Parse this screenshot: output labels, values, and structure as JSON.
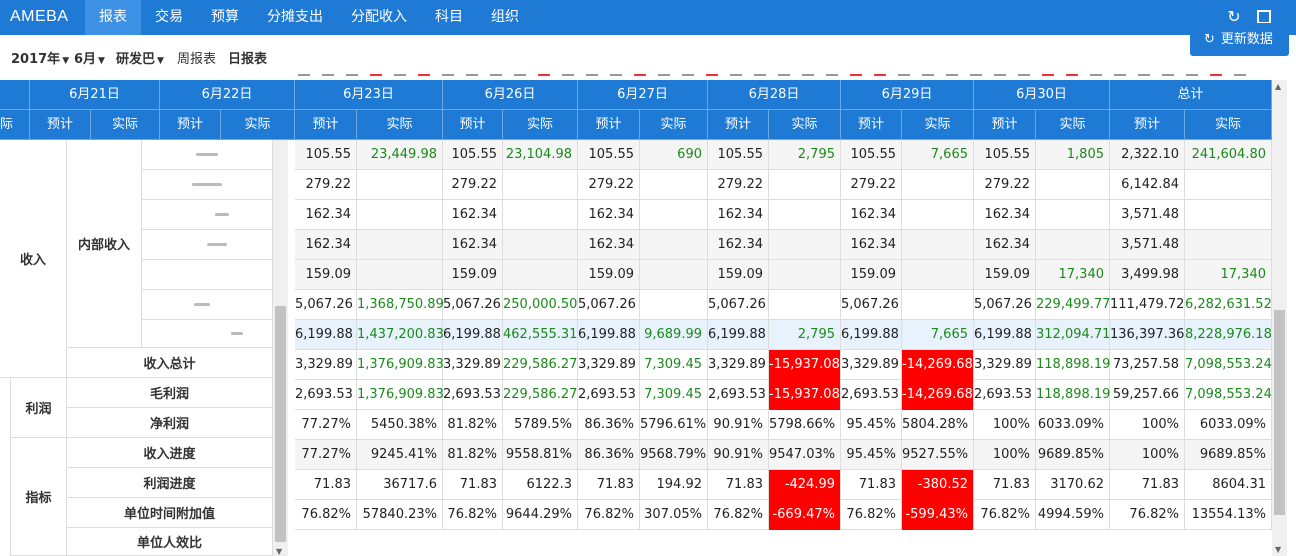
{
  "nav": {
    "brand": "AMEBA",
    "items": [
      {
        "label": "报表",
        "active": true
      },
      {
        "label": "交易"
      },
      {
        "label": "预算"
      },
      {
        "label": "分摊支出"
      },
      {
        "label": "分配收入"
      },
      {
        "label": "科目"
      },
      {
        "label": "组织"
      }
    ],
    "icons": [
      "refresh-icon",
      "expand-icon"
    ]
  },
  "toolbar": {
    "year": "2017年",
    "month": "6月",
    "dept": "研发巴",
    "weekly": "周报表",
    "daily": "日报表",
    "update_label": "更新数据"
  },
  "header": {
    "dates": [
      "6月21日",
      "6月22日",
      "6月23日",
      "6月26日",
      "6月27日",
      "6月28日",
      "6月29日",
      "6月30日",
      "总计"
    ],
    "partial_actual": "际",
    "forecast": "预计",
    "actual": "实际"
  },
  "left": {
    "income": "收入",
    "internal_income": "内部收入",
    "income_total": "收入总计",
    "profit": "利润",
    "gross_profit": "毛利润",
    "net_profit": "净利润",
    "indicators": "指标",
    "income_progress": "收入进度",
    "profit_progress": "利润进度",
    "unit_time_value": "单位时间附加值",
    "per_capita_ratio": "单位人效比"
  },
  "rows": [
    {
      "cells": [
        "105.55",
        "23,449.98",
        "105.55",
        "23,104.98",
        "105.55",
        "690",
        "105.55",
        "2,795",
        "105.55",
        "7,665",
        "105.55",
        "1,805",
        "2,322.10",
        "241,604.80"
      ],
      "green": [
        1,
        3,
        5,
        7,
        9,
        11,
        13
      ],
      "red": []
    },
    {
      "cells": [
        "279.22",
        "",
        "279.22",
        "",
        "279.22",
        "",
        "279.22",
        "",
        "279.22",
        "",
        "279.22",
        "",
        "6,142.84",
        ""
      ],
      "green": [],
      "red": []
    },
    {
      "cells": [
        "162.34",
        "",
        "162.34",
        "",
        "162.34",
        "",
        "162.34",
        "",
        "162.34",
        "",
        "162.34",
        "",
        "3,571.48",
        ""
      ],
      "green": [],
      "red": []
    },
    {
      "cells": [
        "162.34",
        "",
        "162.34",
        "",
        "162.34",
        "",
        "162.34",
        "",
        "162.34",
        "",
        "162.34",
        "",
        "3,571.48",
        ""
      ],
      "green": [],
      "red": []
    },
    {
      "cells": [
        "159.09",
        "",
        "159.09",
        "",
        "159.09",
        "",
        "159.09",
        "",
        "159.09",
        "",
        "159.09",
        "17,340",
        "3,499.98",
        "17,340"
      ],
      "green": [
        11,
        13
      ],
      "red": []
    },
    {
      "cells": [
        "5,067.26",
        "1,368,750.89",
        "5,067.26",
        "250,000.50",
        "5,067.26",
        "",
        "5,067.26",
        "",
        "5,067.26",
        "",
        "5,067.26",
        "229,499.77",
        "111,479.72",
        "6,282,631.52"
      ],
      "green": [
        1,
        3,
        11,
        13
      ],
      "red": []
    },
    {
      "cells": [
        "6,199.88",
        "1,437,200.83",
        "6,199.88",
        "462,555.31",
        "6,199.88",
        "9,689.99",
        "6,199.88",
        "2,795",
        "6,199.88",
        "7,665",
        "6,199.88",
        "312,094.71",
        "136,397.36",
        "8,228,976.18"
      ],
      "green": [
        1,
        3,
        5,
        7,
        9,
        11,
        13
      ],
      "red": []
    },
    {
      "cells": [
        "3,329.89",
        "1,376,909.83",
        "3,329.89",
        "229,586.27",
        "3,329.89",
        "7,309.45",
        "3,329.89",
        "-15,937.08",
        "3,329.89",
        "-14,269.68",
        "3,329.89",
        "118,898.19",
        "73,257.58",
        "7,098,553.24"
      ],
      "green": [
        1,
        3,
        5,
        11,
        13
      ],
      "red": [
        7,
        9
      ]
    },
    {
      "cells": [
        "2,693.53",
        "1,376,909.83",
        "2,693.53",
        "229,586.27",
        "2,693.53",
        "7,309.45",
        "2,693.53",
        "-15,937.08",
        "2,693.53",
        "-14,269.68",
        "2,693.53",
        "118,898.19",
        "59,257.66",
        "7,098,553.24"
      ],
      "green": [
        1,
        3,
        5,
        11,
        13
      ],
      "red": [
        7,
        9
      ]
    },
    {
      "cells": [
        "77.27%",
        "5450.38%",
        "81.82%",
        "5789.5%",
        "86.36%",
        "5796.61%",
        "90.91%",
        "5798.66%",
        "95.45%",
        "5804.28%",
        "100%",
        "6033.09%",
        "100%",
        "6033.09%"
      ],
      "green": [],
      "red": []
    },
    {
      "cells": [
        "77.27%",
        "9245.41%",
        "81.82%",
        "9558.81%",
        "86.36%",
        "9568.79%",
        "90.91%",
        "9547.03%",
        "95.45%",
        "9527.55%",
        "100%",
        "9689.85%",
        "100%",
        "9689.85%"
      ],
      "green": [],
      "red": []
    },
    {
      "cells": [
        "71.83",
        "36717.6",
        "71.83",
        "6122.3",
        "71.83",
        "194.92",
        "71.83",
        "-424.99",
        "71.83",
        "-380.52",
        "71.83",
        "3170.62",
        "71.83",
        "8604.31"
      ],
      "green": [],
      "red": [
        7,
        9
      ]
    },
    {
      "cells": [
        "76.82%",
        "57840.23%",
        "76.82%",
        "9644.29%",
        "76.82%",
        "307.05%",
        "76.82%",
        "-669.47%",
        "76.82%",
        "-599.43%",
        "76.82%",
        "4994.59%",
        "76.82%",
        "13554.13%"
      ],
      "green": [],
      "red": [
        7,
        9
      ]
    }
  ],
  "colors": {
    "accent": "#1f7ad6",
    "green": "#1a8a1a",
    "red": "#ff0000"
  }
}
